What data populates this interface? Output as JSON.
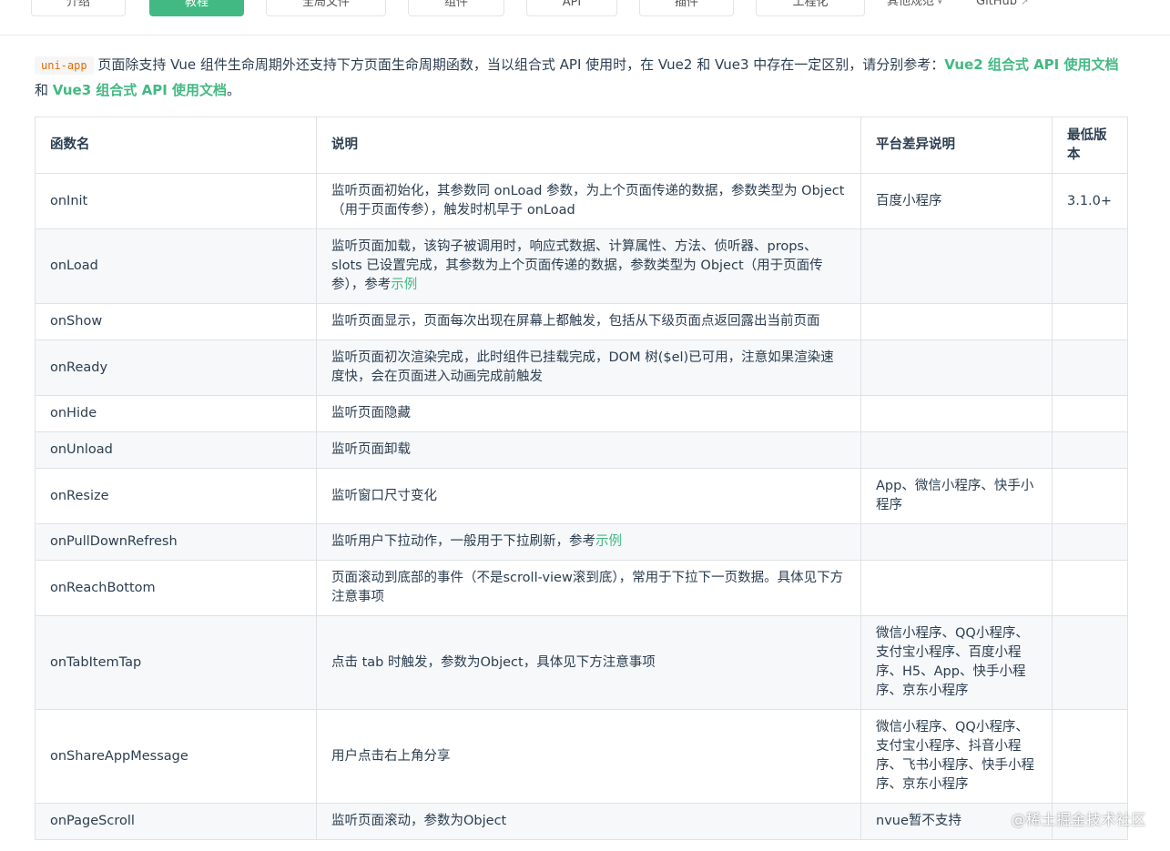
{
  "nav": {
    "items": [
      "介绍",
      "教程",
      "全局文件",
      "组件",
      "API",
      "插件",
      "工程化"
    ],
    "active_index": 1,
    "other_label": "其他规范",
    "github_label": "GitHub"
  },
  "intro": {
    "code": "uni-app",
    "text1": "页面除支持 Vue 组件生命周期外还支持下方页面生命周期函数，当以组合式 API 使用时，在 Vue2 和 Vue3 中存在一定区别，请分别参考：",
    "link1": "Vue2 组合式 API 使用文档",
    "text2": " 和 ",
    "link2": "Vue3 组合式 API 使用文档",
    "text3": "。"
  },
  "table": {
    "headers": [
      "函数名",
      "说明",
      "平台差异说明",
      "最低版本"
    ],
    "rows": [
      {
        "name": "onInit",
        "desc": "监听页面初始化，其参数同 onLoad 参数，为上个页面传递的数据，参数类型为 Object（用于页面传参），触发时机早于 onLoad",
        "desc_link": "",
        "platform": "百度小程序",
        "version": "3.1.0+"
      },
      {
        "name": "onLoad",
        "desc": "监听页面加载，该钩子被调用时，响应式数据、计算属性、方法、侦听器、props、slots 已设置完成，其参数为上个页面传递的数据，参数类型为 Object（用于页面传参），参考",
        "desc_link": "示例",
        "platform": "",
        "version": ""
      },
      {
        "name": "onShow",
        "desc": "监听页面显示，页面每次出现在屏幕上都触发，包括从下级页面点返回露出当前页面",
        "desc_link": "",
        "platform": "",
        "version": ""
      },
      {
        "name": "onReady",
        "desc": "监听页面初次渲染完成，此时组件已挂载完成，DOM 树($el)已可用，注意如果渲染速度快，会在页面进入动画完成前触发",
        "desc_link": "",
        "platform": "",
        "version": ""
      },
      {
        "name": "onHide",
        "desc": "监听页面隐藏",
        "desc_link": "",
        "platform": "",
        "version": ""
      },
      {
        "name": "onUnload",
        "desc": "监听页面卸载",
        "desc_link": "",
        "platform": "",
        "version": ""
      },
      {
        "name": "onResize",
        "desc": "监听窗口尺寸变化",
        "desc_link": "",
        "platform": "App、微信小程序、快手小程序",
        "version": ""
      },
      {
        "name": "onPullDownRefresh",
        "desc": "监听用户下拉动作，一般用于下拉刷新，参考",
        "desc_link": "示例",
        "platform": "",
        "version": ""
      },
      {
        "name": "onReachBottom",
        "desc": "页面滚动到底部的事件（不是scroll-view滚到底），常用于下拉下一页数据。具体见下方注意事项",
        "desc_link": "",
        "platform": "",
        "version": ""
      },
      {
        "name": "onTabItemTap",
        "desc": "点击 tab 时触发，参数为Object，具体见下方注意事项",
        "desc_link": "",
        "platform": "微信小程序、QQ小程序、支付宝小程序、百度小程序、H5、App、快手小程序、京东小程序",
        "version": ""
      },
      {
        "name": "onShareAppMessage",
        "desc": "用户点击右上角分享",
        "desc_link": "",
        "platform": "微信小程序、QQ小程序、支付宝小程序、抖音小程序、飞书小程序、快手小程序、京东小程序",
        "version": ""
      },
      {
        "name": "onPageScroll",
        "desc": "监听页面滚动，参数为Object",
        "desc_link": "",
        "platform": "nvue暂不支持",
        "version": ""
      }
    ]
  },
  "watermark": "@稀土掘金技术社区"
}
